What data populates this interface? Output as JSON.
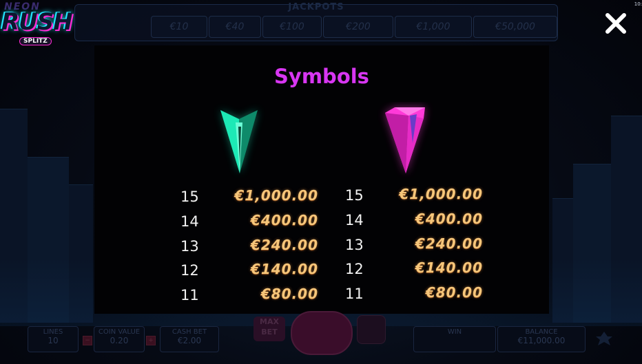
{
  "logo": {
    "top": "NEON",
    "main": "RUSH",
    "badge": "SPLITZ"
  },
  "clock": "10:",
  "jackpots": {
    "title": "JACKPOTS",
    "values": [
      "€10",
      "€40",
      "€100",
      "€200",
      "€1,000",
      "€50,000"
    ]
  },
  "symbols_panel": {
    "title": "Symbols",
    "symbols": [
      {
        "icon": "green-crystal-icon",
        "color": "#1de9b6",
        "paytable": [
          {
            "count": "15",
            "amount": "€1,000.00"
          },
          {
            "count": "14",
            "amount": "€400.00"
          },
          {
            "count": "13",
            "amount": "€240.00"
          },
          {
            "count": "12",
            "amount": "€140.00"
          },
          {
            "count": "11",
            "amount": "€80.00"
          }
        ]
      },
      {
        "icon": "pink-crystal-icon",
        "color": "#ff3ad8",
        "paytable": [
          {
            "count": "15",
            "amount": "€1,000.00"
          },
          {
            "count": "14",
            "amount": "€400.00"
          },
          {
            "count": "13",
            "amount": "€240.00"
          },
          {
            "count": "12",
            "amount": "€140.00"
          },
          {
            "count": "11",
            "amount": "€80.00"
          }
        ]
      }
    ]
  },
  "bottom_bar": {
    "lines": {
      "label": "LINES",
      "value": "10"
    },
    "coin_value": {
      "label": "COIN VALUE",
      "value": "0.20"
    },
    "cash_bet": {
      "label": "CASH BET",
      "value": "€2.00"
    },
    "max_bet": {
      "line1": "MAX",
      "line2": "BET"
    },
    "win": {
      "label": "WIN",
      "value": ""
    },
    "balance": {
      "label": "BALANCE",
      "value": "€11,000.00"
    }
  },
  "colors": {
    "title": "#d836f2",
    "amount": "#f6c67a",
    "close": "#ffffff"
  }
}
